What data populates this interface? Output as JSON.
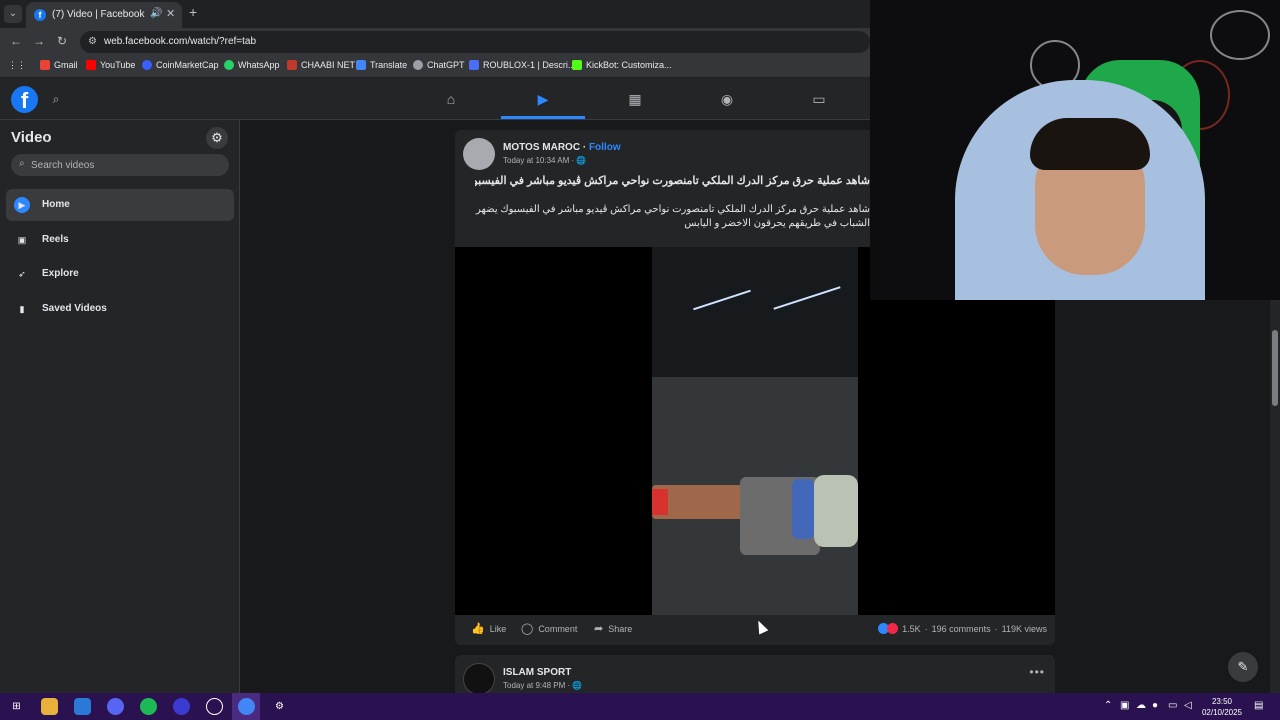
{
  "browser": {
    "tab_title": "(7) Video | Facebook",
    "url": "web.facebook.com/watch/?ref=tab",
    "bookmarks": [
      "Gmail",
      "YouTube",
      "CoinMarketCap",
      "WhatsApp",
      "CHAABI NET",
      "Translate",
      "ChatGPT",
      "ROUBLOX-1 | Descri...",
      "KickBot: Customiza..."
    ]
  },
  "sidebar": {
    "title": "Video",
    "search_placeholder": "Search videos",
    "items": [
      {
        "label": "Home",
        "icon": "video-home-icon",
        "active": true
      },
      {
        "label": "Reels",
        "icon": "reels-icon"
      },
      {
        "label": "Explore",
        "icon": "explore-rocket-icon"
      },
      {
        "label": "Saved Videos",
        "icon": "bookmark-icon"
      }
    ]
  },
  "posts": [
    {
      "author": "MOTOS MAROC",
      "follow": "Follow",
      "time": "Today at 10:34 AM ·",
      "text1": "شاهد عملية حرق مركز الدرك الملكي تامنصورت نواحي مراكش ڤيديو مباشر في الفيسبوك يضهر",
      "text2": "شاهد عملية حرق مركز الدرك الملكي تامنصورت نواحي مراكش ڤيديو مباشر في الفيسبوك يضهر الشباب في طريقهم يحرقون الاخضر و اليابس",
      "actions": {
        "like": "Like",
        "comment": "Comment",
        "share": "Share"
      },
      "stats": {
        "reactions": "1.5K",
        "comments": "196 comments",
        "views": "119K views"
      }
    },
    {
      "author": "ISLAM SPORT",
      "time": "Today at 9:48 PM ·"
    }
  ],
  "taskbar": {
    "date": "02/10/2025",
    "time": "23:50"
  },
  "colors": {
    "accent": "#2d88ff",
    "facebook_blue": "#1877f2",
    "taskbar": "#2a1250"
  }
}
